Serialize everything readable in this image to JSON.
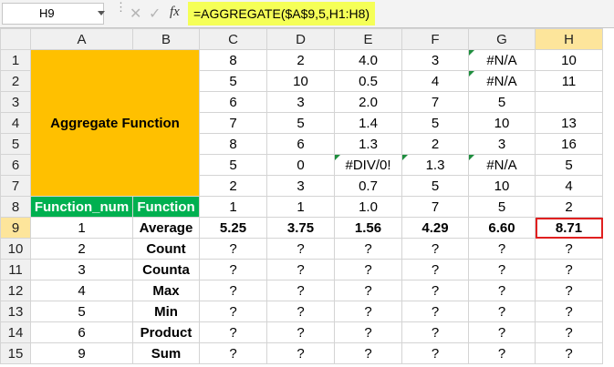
{
  "formula_bar": {
    "name_box": "H9",
    "fx": "fx",
    "cancel": "✕",
    "enter": "✓",
    "formula": "=AGGREGATE($A$9,5,H1:H8)"
  },
  "columns": [
    "A",
    "B",
    "C",
    "D",
    "E",
    "F",
    "G",
    "H"
  ],
  "rows": [
    "1",
    "2",
    "3",
    "4",
    "5",
    "6",
    "7",
    "8",
    "9",
    "10",
    "11",
    "12",
    "13",
    "14",
    "15"
  ],
  "merged_title": "Aggregate Function",
  "data_rows": [
    [
      "8",
      "2",
      "4.0",
      "3",
      "#N/A",
      "10"
    ],
    [
      "5",
      "10",
      "0.5",
      "4",
      "#N/A",
      "11"
    ],
    [
      "6",
      "3",
      "2.0",
      "7",
      "5",
      ""
    ],
    [
      "7",
      "5",
      "1.4",
      "5",
      "10",
      "13"
    ],
    [
      "8",
      "6",
      "1.3",
      "2",
      "3",
      "16"
    ],
    [
      "5",
      "0",
      "#DIV/0!",
      "1.3",
      "#N/A",
      "5"
    ],
    [
      "2",
      "3",
      "0.7",
      "5",
      "10",
      "4"
    ]
  ],
  "header_row": {
    "a": "Function_num",
    "b": "Function",
    "values": [
      "1",
      "1",
      "1.0",
      "7",
      "5",
      "2"
    ]
  },
  "function_rows": [
    {
      "num": "1",
      "name": "Average",
      "values": [
        "5.25",
        "3.75",
        "1.56",
        "4.29",
        "6.60",
        "8.71"
      ]
    },
    {
      "num": "2",
      "name": "Count",
      "values": [
        "?",
        "?",
        "?",
        "?",
        "?",
        "?"
      ]
    },
    {
      "num": "3",
      "name": "Counta",
      "values": [
        "?",
        "?",
        "?",
        "?",
        "?",
        "?"
      ]
    },
    {
      "num": "4",
      "name": "Max",
      "values": [
        "?",
        "?",
        "?",
        "?",
        "?",
        "?"
      ]
    },
    {
      "num": "5",
      "name": "Min",
      "values": [
        "?",
        "?",
        "?",
        "?",
        "?",
        "?"
      ]
    },
    {
      "num": "6",
      "name": "Product",
      "values": [
        "?",
        "?",
        "?",
        "?",
        "?",
        "?"
      ]
    },
    {
      "num": "9",
      "name": "Sum",
      "values": [
        "?",
        "?",
        "?",
        "?",
        "?",
        "?"
      ]
    }
  ],
  "colors": {
    "title_fill": "#ffc000",
    "header_fill": "#00b050",
    "formula_highlight": "#f5ff57",
    "active_cell_border": "#e02020"
  }
}
